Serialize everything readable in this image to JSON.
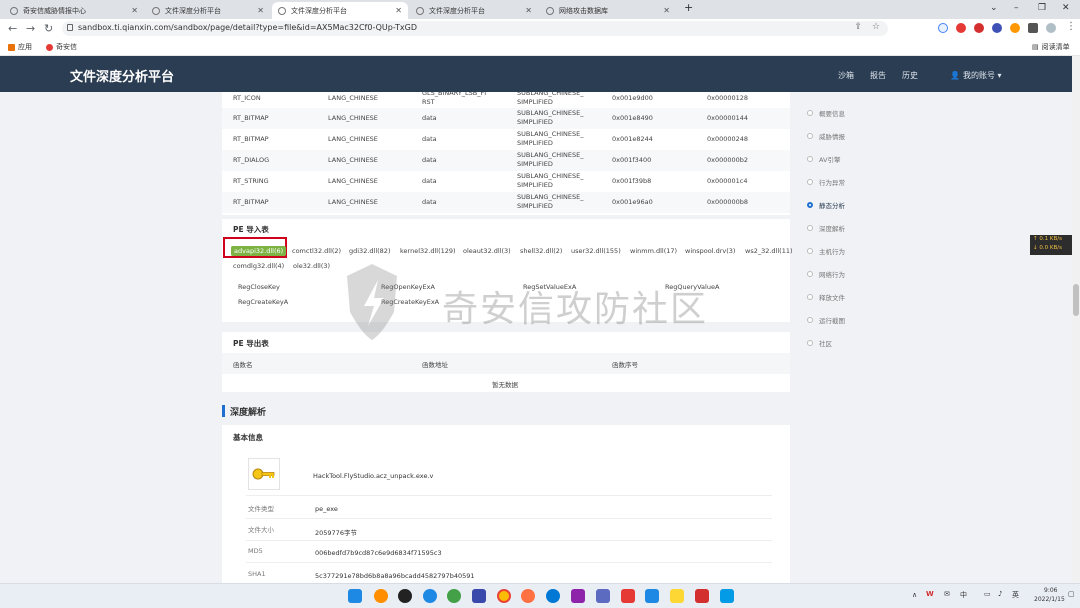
{
  "browser": {
    "tabs": [
      {
        "label": "奇安信威胁情报中心",
        "active": false
      },
      {
        "label": "文件深度分析平台",
        "active": false
      },
      {
        "label": "文件深度分析平台",
        "active": true
      },
      {
        "label": "文件深度分析平台",
        "active": false
      },
      {
        "label": "网络攻击数据库",
        "active": false
      }
    ],
    "new_tab": "+",
    "window_controls": [
      "⌄",
      "–",
      "❐",
      "✕"
    ],
    "url": "sandbox.ti.qianxin.com/sandbox/page/detail?type=file&id=AX5Mac32Cf0-QUp-TxGD",
    "bookmarks": [
      {
        "label": "应用"
      },
      {
        "label": "奇安信"
      }
    ],
    "reading_list": "阅读清单"
  },
  "site": {
    "title": "文件深度分析平台",
    "nav": [
      "沙箱",
      "报告",
      "历史"
    ],
    "account": "我的账号 ▾"
  },
  "resources": {
    "rows": [
      {
        "type": "RT_ICON",
        "lang": "LANG_CHINESE",
        "data": "GLS_BINARY_LSB_FI\nRST",
        "sublang": "SUBLANG_CHINESE_\nSIMPLIFIED",
        "offset": "0x001e9d00",
        "size": "0x00000128"
      },
      {
        "type": "RT_BITMAP",
        "lang": "LANG_CHINESE",
        "data": "data",
        "sublang": "SUBLANG_CHINESE_\nSIMPLIFIED",
        "offset": "0x001e8490",
        "size": "0x00000144"
      },
      {
        "type": "RT_BITMAP",
        "lang": "LANG_CHINESE",
        "data": "data",
        "sublang": "SUBLANG_CHINESE_\nSIMPLIFIED",
        "offset": "0x001e8244",
        "size": "0x00000248"
      },
      {
        "type": "RT_DIALOG",
        "lang": "LANG_CHINESE",
        "data": "data",
        "sublang": "SUBLANG_CHINESE_\nSIMPLIFIED",
        "offset": "0x001f3400",
        "size": "0x000000b2"
      },
      {
        "type": "RT_STRING",
        "lang": "LANG_CHINESE",
        "data": "data",
        "sublang": "SUBLANG_CHINESE_\nSIMPLIFIED",
        "offset": "0x001f39b8",
        "size": "0x000001c4"
      },
      {
        "type": "RT_BITMAP",
        "lang": "LANG_CHINESE",
        "data": "data",
        "sublang": "SUBLANG_CHINESE_\nSIMPLIFIED",
        "offset": "0x001e96a0",
        "size": "0x000000b8"
      }
    ]
  },
  "imports": {
    "title": "PE 导入表",
    "dlls_row1": [
      "advapi32.dll(6)",
      "comctl32.dll(2)",
      "gdi32.dll(82)",
      "kernel32.dll(129)",
      "oleaut32.dll(3)",
      "shell32.dll(2)",
      "user32.dll(155)",
      "winmm.dll(17)",
      "winspool.drv(3)",
      "ws2_32.dll(11)"
    ],
    "dlls_row2": [
      "comdlg32.dll(4)",
      "ole32.dll(3)"
    ],
    "functions": [
      "RegCloseKey",
      "RegOpenKeyExA",
      "RegSetValueExA",
      "RegQueryValueA",
      "RegCreateKeyA",
      "RegCreateKeyExA"
    ]
  },
  "exports": {
    "title": "PE 导出表",
    "columns": [
      "函数名",
      "函数地址",
      "函数序号"
    ],
    "empty": "暂无数据"
  },
  "deep": {
    "title": "深度解析",
    "basic_title": "基本信息",
    "filename": "HackTool.FlyStudio.acz_unpack.exe.v",
    "fields": [
      {
        "label": "文件类型",
        "value": "pe_exe"
      },
      {
        "label": "文件大小",
        "value": "2059776字节"
      },
      {
        "label": "MD5",
        "value": "006bedfd7b9cd87c6e9d6834f71595c3"
      },
      {
        "label": "SHA1",
        "value": "5c377291e78bd6b8a8a96bcadd4582797b40591"
      }
    ]
  },
  "sidenav": [
    {
      "label": "概要信息",
      "active": false
    },
    {
      "label": "威胁情报",
      "active": false
    },
    {
      "label": "AV引擎",
      "active": false
    },
    {
      "label": "行为异常",
      "active": false
    },
    {
      "label": "静态分析",
      "active": true
    },
    {
      "label": "深度解析",
      "active": false
    },
    {
      "label": "主机行为",
      "active": false
    },
    {
      "label": "网络行为",
      "active": false
    },
    {
      "label": "释放文件",
      "active": false
    },
    {
      "label": "运行截图",
      "active": false
    },
    {
      "label": "社区",
      "active": false
    }
  ],
  "speed_widget": {
    "up": "↑ 0.1 KB/s",
    "down": "↓ 0.0 KB/s"
  },
  "watermark": "奇安信攻防社区",
  "taskbar": {
    "time": "9:06",
    "date": "2022/1/15"
  },
  "colors": {
    "header": "#2b3d52",
    "accent": "#1f6fd0",
    "selected_dll": "#7cb342",
    "highlight_box": "#d0021b"
  }
}
